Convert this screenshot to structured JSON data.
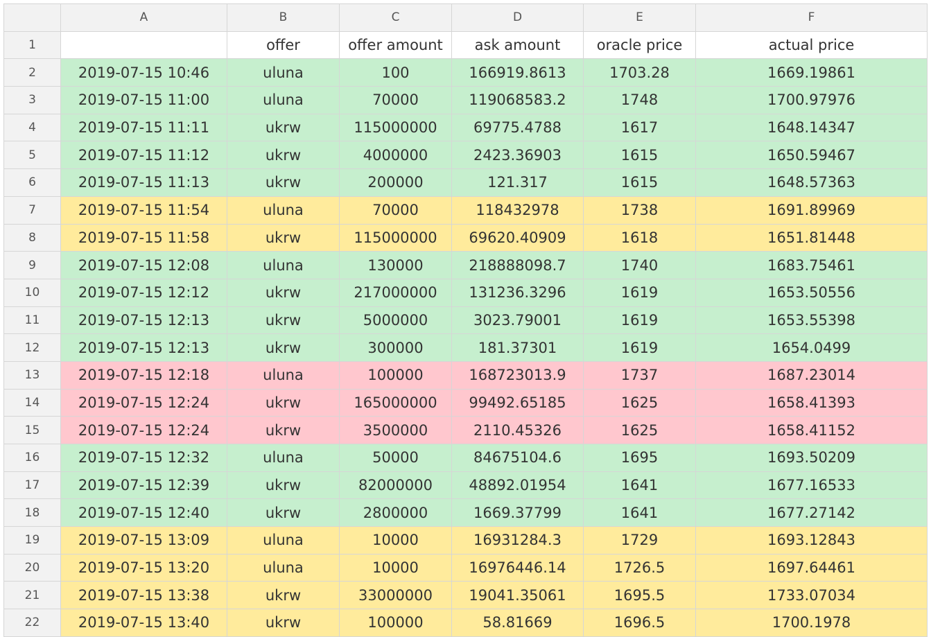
{
  "columns": [
    "A",
    "B",
    "C",
    "D",
    "E",
    "F"
  ],
  "header_row": {
    "number": "1",
    "cells": [
      "",
      "offer",
      "offer amount",
      "ask amount",
      "oracle price",
      "actual price"
    ]
  },
  "colors": {
    "green": "#c6efce",
    "yellow": "#ffeb9c",
    "red": "#ffc7ce",
    "header_bg": "#f2f2f2"
  },
  "rows": [
    {
      "number": "2",
      "highlight": "green",
      "cells": [
        "2019-07-15 10:46",
        "uluna",
        "100",
        "166919.8613",
        "1703.28",
        "1669.19861"
      ]
    },
    {
      "number": "3",
      "highlight": "green",
      "cells": [
        "2019-07-15 11:00",
        "uluna",
        "70000",
        "119068583.2",
        "1748",
        "1700.97976"
      ]
    },
    {
      "number": "4",
      "highlight": "green",
      "cells": [
        "2019-07-15 11:11",
        "ukrw",
        "115000000",
        "69775.4788",
        "1617",
        "1648.14347"
      ]
    },
    {
      "number": "5",
      "highlight": "green",
      "cells": [
        "2019-07-15 11:12",
        "ukrw",
        "4000000",
        "2423.36903",
        "1615",
        "1650.59467"
      ]
    },
    {
      "number": "6",
      "highlight": "green",
      "cells": [
        "2019-07-15 11:13",
        "ukrw",
        "200000",
        "121.317",
        "1615",
        "1648.57363"
      ]
    },
    {
      "number": "7",
      "highlight": "yellow",
      "cells": [
        "2019-07-15 11:54",
        "uluna",
        "70000",
        "118432978",
        "1738",
        "1691.89969"
      ]
    },
    {
      "number": "8",
      "highlight": "yellow",
      "cells": [
        "2019-07-15 11:58",
        "ukrw",
        "115000000",
        "69620.40909",
        "1618",
        "1651.81448"
      ]
    },
    {
      "number": "9",
      "highlight": "green",
      "cells": [
        "2019-07-15 12:08",
        "uluna",
        "130000",
        "218888098.7",
        "1740",
        "1683.75461"
      ]
    },
    {
      "number": "10",
      "highlight": "green",
      "cells": [
        "2019-07-15 12:12",
        "ukrw",
        "217000000",
        "131236.3296",
        "1619",
        "1653.50556"
      ]
    },
    {
      "number": "11",
      "highlight": "green",
      "cells": [
        "2019-07-15 12:13",
        "ukrw",
        "5000000",
        "3023.79001",
        "1619",
        "1653.55398"
      ]
    },
    {
      "number": "12",
      "highlight": "green",
      "cells": [
        "2019-07-15 12:13",
        "ukrw",
        "300000",
        "181.37301",
        "1619",
        "1654.0499"
      ]
    },
    {
      "number": "13",
      "highlight": "red",
      "cells": [
        "2019-07-15 12:18",
        "uluna",
        "100000",
        "168723013.9",
        "1737",
        "1687.23014"
      ]
    },
    {
      "number": "14",
      "highlight": "red",
      "cells": [
        "2019-07-15 12:24",
        "ukrw",
        "165000000",
        "99492.65185",
        "1625",
        "1658.41393"
      ]
    },
    {
      "number": "15",
      "highlight": "red",
      "cells": [
        "2019-07-15 12:24",
        "ukrw",
        "3500000",
        "2110.45326",
        "1625",
        "1658.41152"
      ]
    },
    {
      "number": "16",
      "highlight": "green",
      "cells": [
        "2019-07-15 12:32",
        "uluna",
        "50000",
        "84675104.6",
        "1695",
        "1693.50209"
      ]
    },
    {
      "number": "17",
      "highlight": "green",
      "cells": [
        "2019-07-15 12:39",
        "ukrw",
        "82000000",
        "48892.01954",
        "1641",
        "1677.16533"
      ]
    },
    {
      "number": "18",
      "highlight": "green",
      "cells": [
        "2019-07-15 12:40",
        "ukrw",
        "2800000",
        "1669.37799",
        "1641",
        "1677.27142"
      ]
    },
    {
      "number": "19",
      "highlight": "yellow",
      "cells": [
        "2019-07-15 13:09",
        "uluna",
        "10000",
        "16931284.3",
        "1729",
        "1693.12843"
      ]
    },
    {
      "number": "20",
      "highlight": "yellow",
      "cells": [
        "2019-07-15 13:20",
        "uluna",
        "10000",
        "16976446.14",
        "1726.5",
        "1697.64461"
      ]
    },
    {
      "number": "21",
      "highlight": "yellow",
      "cells": [
        "2019-07-15 13:38",
        "ukrw",
        "33000000",
        "19041.35061",
        "1695.5",
        "1733.07034"
      ]
    },
    {
      "number": "22",
      "highlight": "yellow",
      "cells": [
        "2019-07-15 13:40",
        "ukrw",
        "100000",
        "58.81669",
        "1696.5",
        "1700.1978"
      ]
    }
  ]
}
